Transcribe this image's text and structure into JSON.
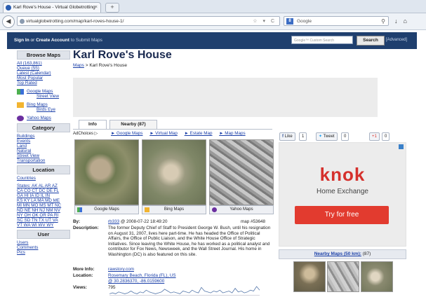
{
  "browser": {
    "tab_title": "Karl Rove's House - Virtual Globetrotting",
    "new_tab_label": "+",
    "url": "virtualglobetrotting.com/map/karl-roves-house-1/",
    "search_engine": "Google"
  },
  "site_header": {
    "sign_in": "Sign In",
    "or": "or",
    "create_account": "Create Account",
    "submit_maps": "to Submit Maps",
    "search_placeholder": "Google™ Custom Search",
    "search_button": "Search",
    "advanced": "[Advanced]"
  },
  "sidebar": {
    "browse_title": "Browse Maps",
    "browse_links": [
      "All (163,861)",
      "Queue (55)",
      "Latest (Calendar)",
      "Most Popular",
      "Top Rated"
    ],
    "services": [
      {
        "name": "Google Maps",
        "sub": "Street View"
      },
      {
        "name": "Bing Maps",
        "sub": "Birds Eye"
      },
      {
        "name": "Yahoo Maps",
        "sub": ""
      }
    ],
    "category_title": "Category",
    "categories": [
      "Buildings",
      "Events",
      "Land",
      "Natural",
      "Street View",
      "Transportation"
    ],
    "location_title": "Location",
    "countries": "Countries",
    "states_rows": [
      "States: AK AL AR AZ",
      "CA CO CT DC DE FL",
      "GA HI IA ID IL IN",
      "KS KY LA MA MD ME",
      "MI MN MO MS MT NC",
      "ND NE NH NJ NM NV",
      "NY OH OK OR PA RI",
      "SC SD TN TX UT VA",
      "VT WA WI WV WY"
    ],
    "user_title": "User",
    "user_links": [
      "Users",
      "Comments",
      "Pics"
    ]
  },
  "main": {
    "title": "Karl Rove's House",
    "breadcrumb_root": "Maps",
    "breadcrumb_current": "> Karl Rove's House",
    "tabs": [
      {
        "label": "Info"
      },
      {
        "label": "Nearby (87)"
      }
    ],
    "adchoices": "AdChoices",
    "ad_links": [
      "► Google Maps",
      "► Virtual Map",
      "► Estate Map",
      "► Map Maps"
    ],
    "thumb_labels": [
      "Google Maps",
      "Bing Maps",
      "Yahoo Maps"
    ],
    "by_label": "By:",
    "by_user": "rb333",
    "by_date": "@ 2008-07-22 18:49:20",
    "map_number": "map #53648",
    "description_label": "Description:",
    "description": "The former Deputy Chief of Staff to President George W. Bush, until his resignation on August 31, 2007, lives here part-time. He has headed the Office of Political Affairs, the Office of Public Liaison, and the White House Office of Strategic Initiatives. Since leaving the White House, he has worked as a political analyst and contributor for Fox News, Newsweek, and the Wall Street Journal. His home in Washington (DC) is also featured on this site.",
    "more_info_label": "More Info:",
    "more_info": "rawstory.com",
    "location_label": "Location:",
    "location_line1": "Rosemary Beach, Florida (FL), US",
    "location_line2": "@ 30.2836370, -86.0159600",
    "views_label": "Views:",
    "views": "795",
    "views_trend": [
      2,
      3,
      2,
      4,
      3,
      2,
      3,
      5,
      3,
      2,
      4,
      3,
      6,
      4,
      3,
      2,
      3,
      4,
      7,
      5,
      3,
      4,
      3,
      2,
      5,
      4,
      3,
      6,
      4,
      3,
      9,
      5,
      4,
      3,
      5,
      4,
      6,
      3,
      4,
      5,
      3,
      8,
      4,
      5,
      3,
      4,
      6,
      5,
      10,
      6
    ]
  },
  "social": {
    "like": "Like",
    "like_count": "1",
    "tweet": "Tweet",
    "tweet_count": "0",
    "plus": "+1",
    "plus_count": "0"
  },
  "ad": {
    "brand": "knok",
    "tagline": "Home Exchange",
    "cta": "Try for free"
  },
  "nearby": {
    "label": "Nearby Maps (50 km):",
    "count": "(87)"
  }
}
